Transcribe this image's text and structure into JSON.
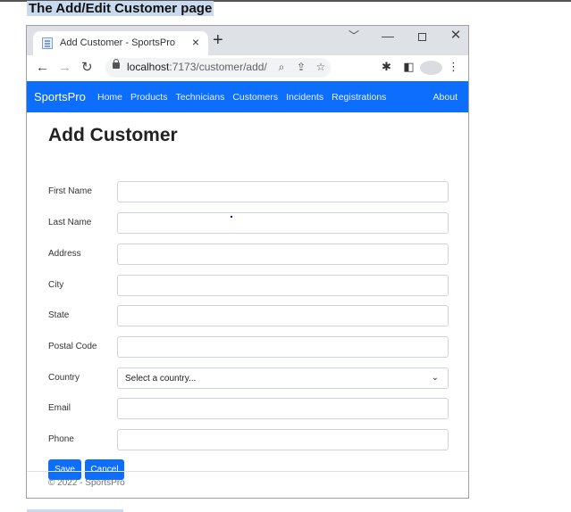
{
  "doc_heading": "The Add/Edit Customer page",
  "browser": {
    "tab_title": "Add Customer - SportsPro",
    "tab_close": "×",
    "new_tab": "+",
    "url_host": "localhost",
    "url_path": ":7173/customer/add/"
  },
  "navbar": {
    "brand": "SportsPro",
    "links": [
      "Home",
      "Products",
      "Technicians",
      "Customers",
      "Incidents",
      "Registrations"
    ],
    "about": "About"
  },
  "page": {
    "title": "Add Customer",
    "fields": [
      {
        "label": "First Name",
        "value": ""
      },
      {
        "label": "Last Name",
        "value": ""
      },
      {
        "label": "Address",
        "value": ""
      },
      {
        "label": "City",
        "value": ""
      },
      {
        "label": "State",
        "value": ""
      },
      {
        "label": "Postal Code",
        "value": ""
      }
    ],
    "country_label": "Country",
    "country_selected": "Select a country...",
    "email_label": "Email",
    "phone_label": "Phone",
    "save_label": "Save",
    "cancel_label": "Cancel"
  },
  "footer": "© 2022 - SportsPro",
  "colors": {
    "navbar": "#0d6efd",
    "button": "#0d6efd"
  }
}
